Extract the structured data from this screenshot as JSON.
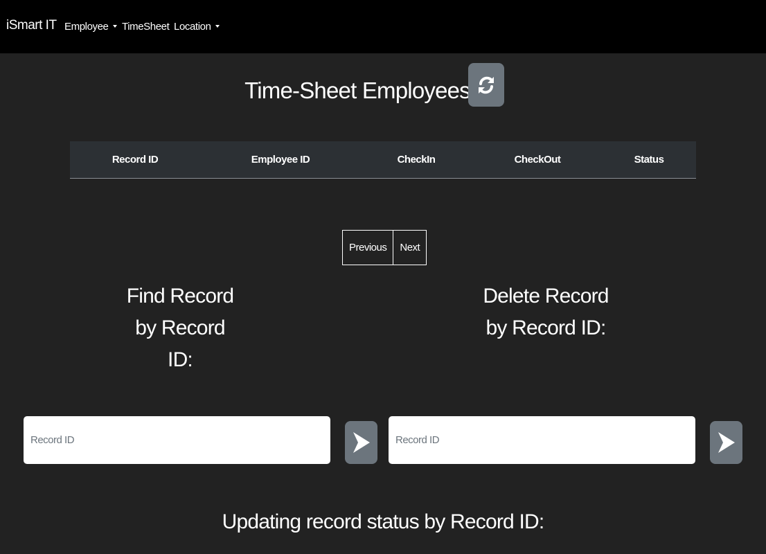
{
  "navbar": {
    "brand": "iSmart IT",
    "items": [
      {
        "label": "Employee",
        "dropdown": true
      },
      {
        "label": "TimeSheet",
        "dropdown": false
      },
      {
        "label": "Location",
        "dropdown": true
      }
    ]
  },
  "main": {
    "title": "Time-Sheet Employees",
    "refresh_icon": "refresh-icon",
    "table": {
      "columns": [
        "Record ID",
        "Employee ID",
        "CheckIn",
        "CheckOut",
        "Status"
      ],
      "rows": []
    },
    "pagination": {
      "previous_label": "Previous",
      "next_label": "Next"
    },
    "find": {
      "heading_lines": [
        "Find Record",
        "by Record",
        "ID:"
      ],
      "input_placeholder": "Record ID",
      "submit_icon": "send-arrow-icon"
    },
    "delete": {
      "heading_lines": [
        "Delete Record",
        "by Record ID:"
      ],
      "input_placeholder": "Record ID",
      "submit_icon": "send-arrow-icon"
    },
    "update": {
      "heading": "Updating record status by Record ID:"
    }
  },
  "colors": {
    "background": "#222222",
    "navbar": "#000000",
    "table_header": "#2c3034",
    "button_secondary": "#6c757d",
    "text": "#ffffff"
  }
}
